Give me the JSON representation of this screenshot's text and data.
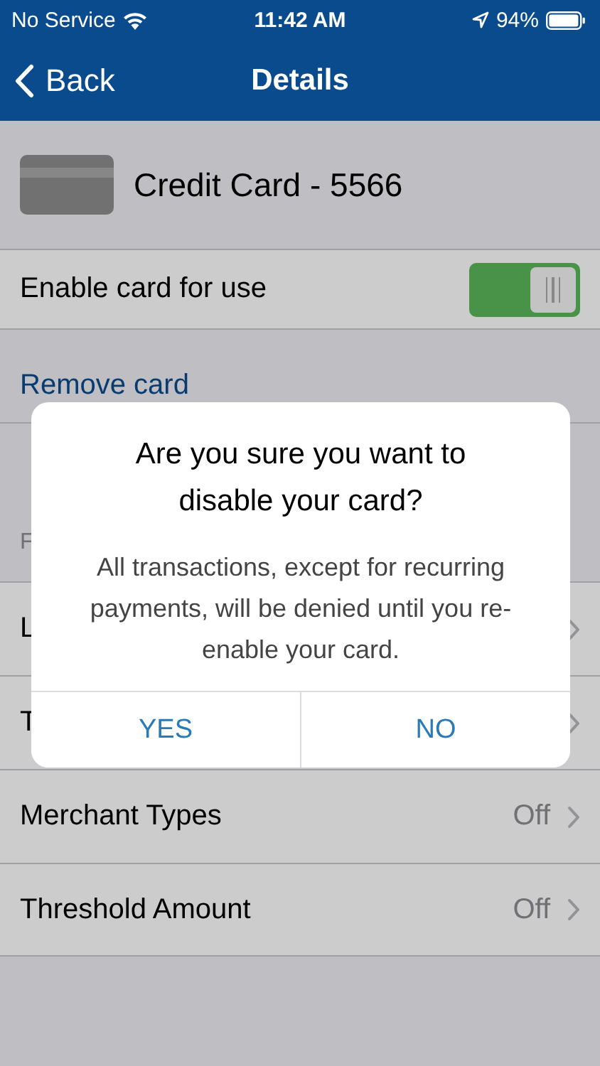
{
  "status_bar": {
    "carrier": "No Service",
    "time": "11:42 AM",
    "battery": "94%"
  },
  "nav": {
    "back": "Back",
    "title": "Details"
  },
  "card": {
    "name": "Credit Card - 5566"
  },
  "enable": {
    "label": "Enable card for use",
    "on": true
  },
  "remove_link": "Remove card",
  "list": [
    {
      "kind": "header",
      "label": "F"
    },
    {
      "kind": "row",
      "label": "L"
    },
    {
      "kind": "row",
      "label": "T"
    },
    {
      "kind": "row",
      "label": "Merchant Types",
      "value": "Off"
    },
    {
      "kind": "row",
      "label": "Threshold Amount",
      "value": "Off"
    }
  ],
  "dialog": {
    "title": "Are you sure you want to disable your card?",
    "message": "All transactions, except for recurring payments, will be denied until you re-enable your card.",
    "buttons": [
      "YES",
      "NO"
    ]
  }
}
